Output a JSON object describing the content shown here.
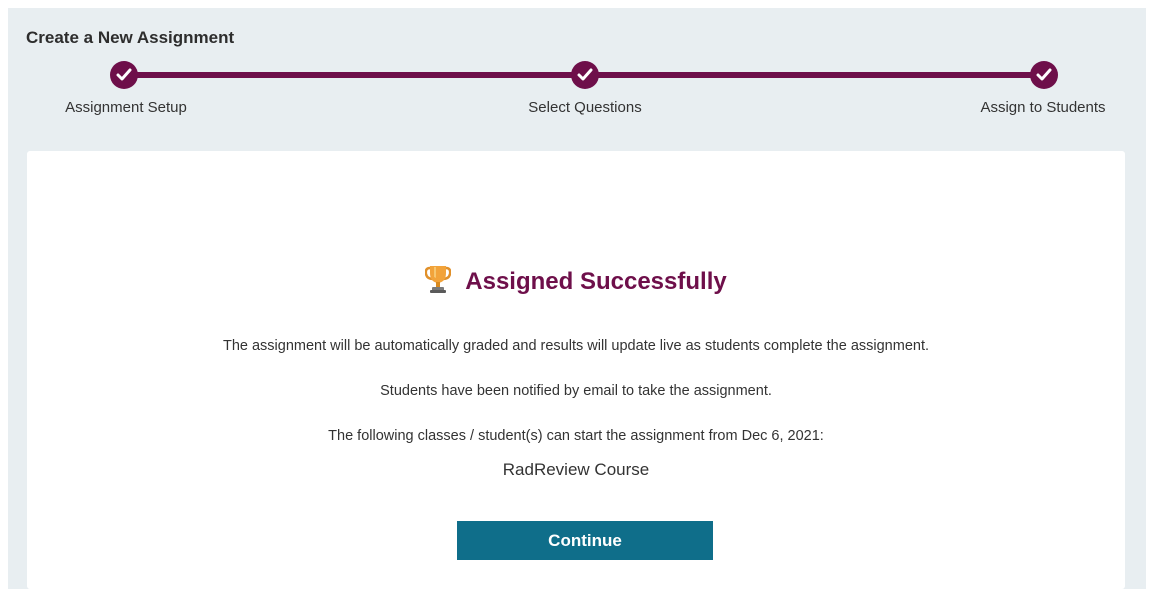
{
  "header": {
    "title": "Create a New Assignment"
  },
  "stepper": {
    "steps": [
      {
        "label": "Assignment Setup",
        "completed": true
      },
      {
        "label": "Select Questions",
        "completed": true
      },
      {
        "label": "Assign to Students",
        "completed": true
      }
    ],
    "accent_color": "#6e0f4a"
  },
  "result": {
    "icon": "trophy-icon",
    "title": "Assigned Successfully",
    "message_graded": "The assignment will be automatically graded and results will update live as students complete the assignment.",
    "message_notified": "Students have been notified by email to take the assignment.",
    "message_start": "The following classes / student(s) can start the assignment from Dec 6, 2021:",
    "class_name": "RadReview Course"
  },
  "actions": {
    "continue_label": "Continue",
    "button_color": "#0f6e8a"
  }
}
